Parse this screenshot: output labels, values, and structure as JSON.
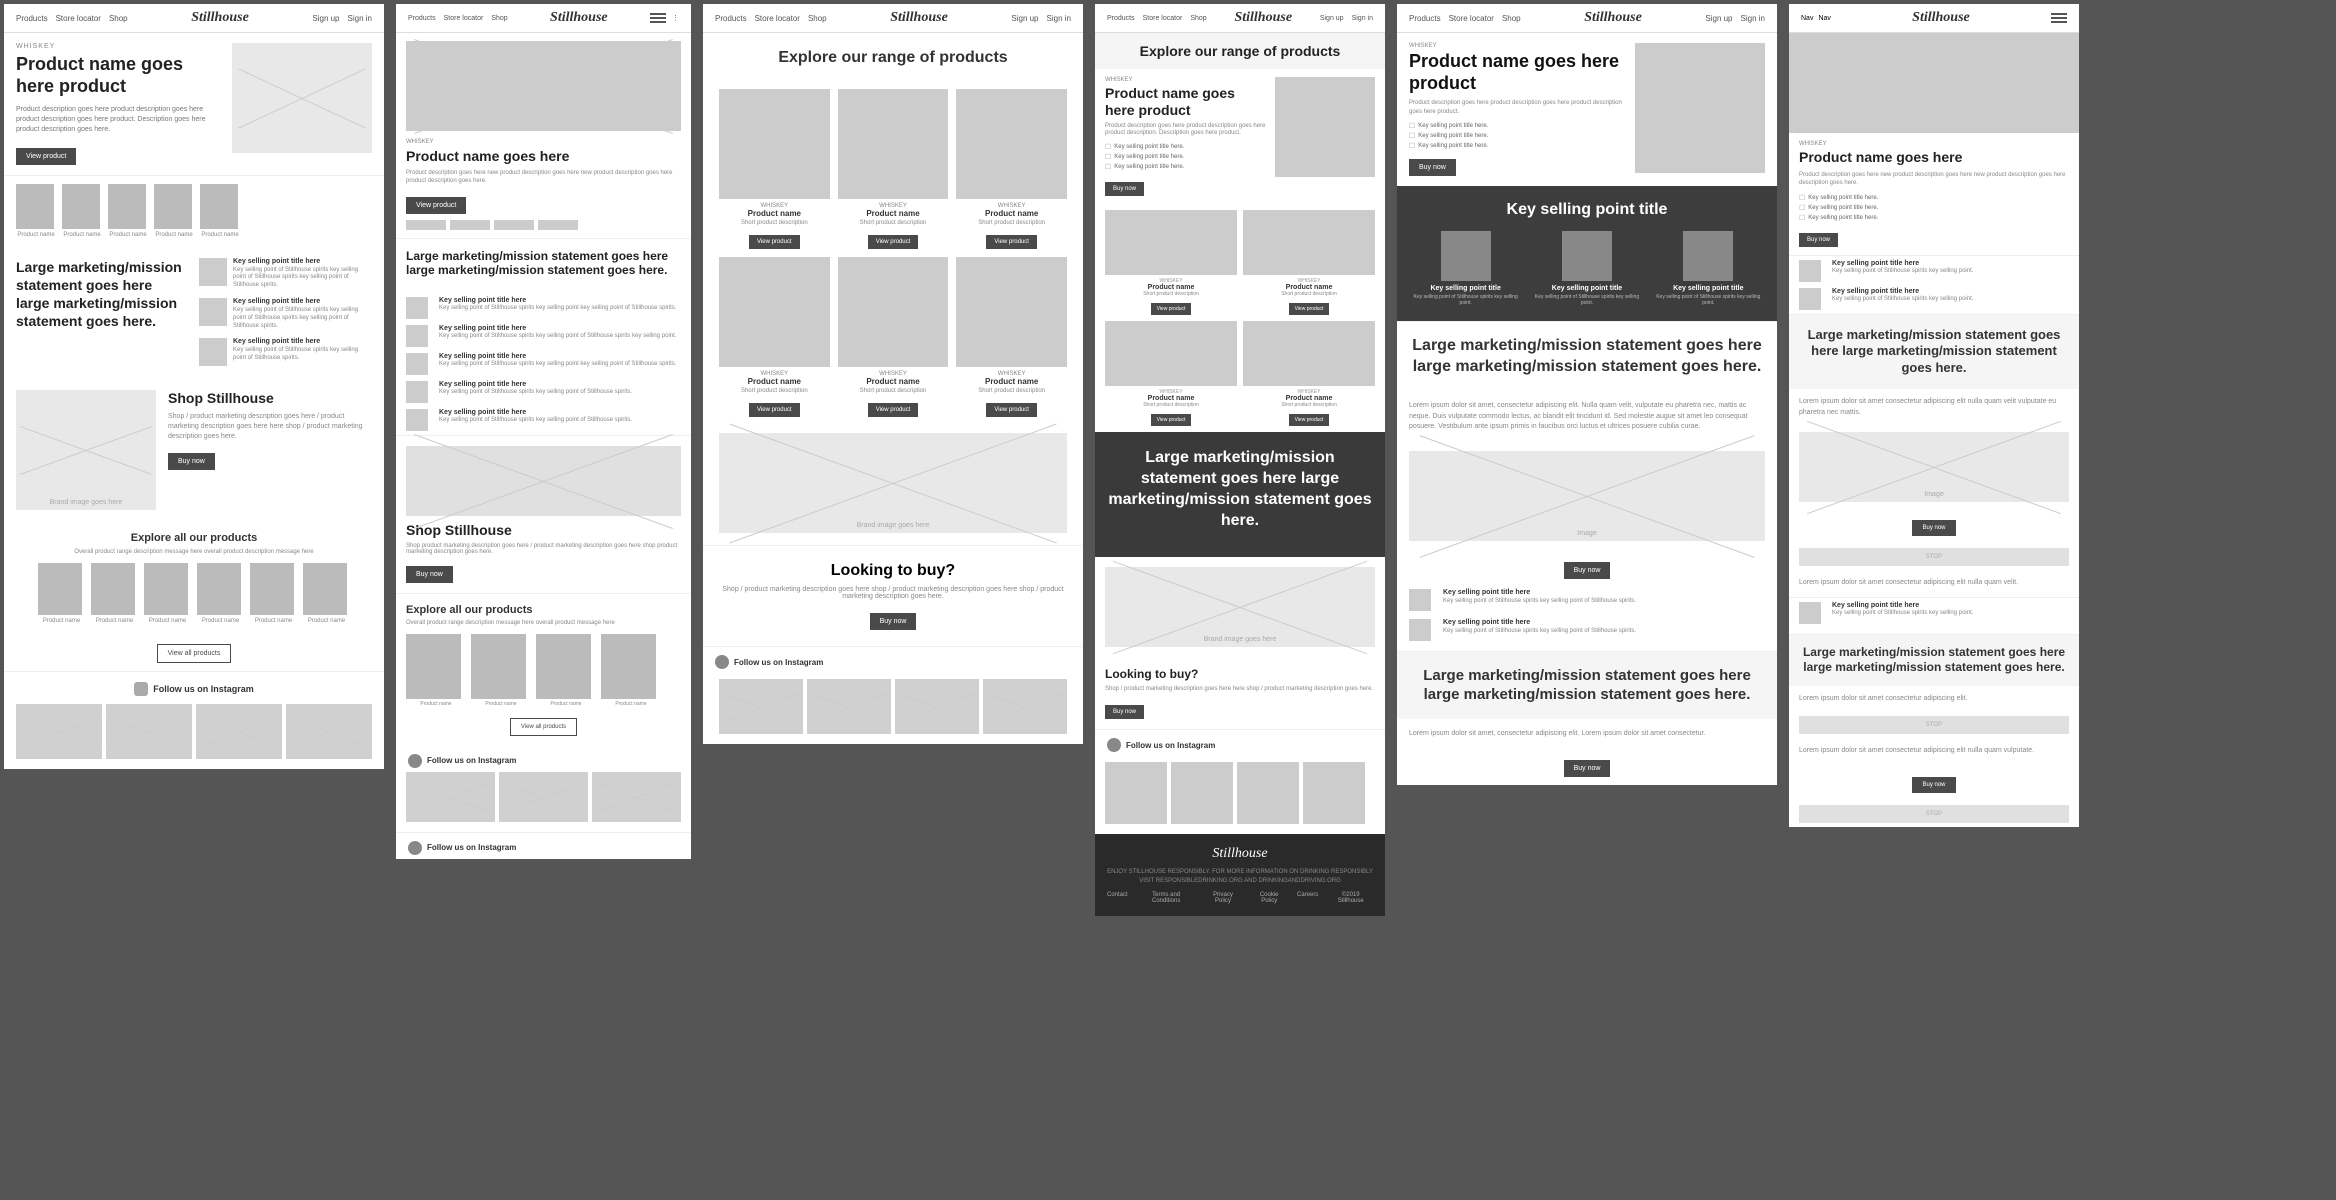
{
  "panels": [
    {
      "id": "panel1",
      "type": "homepage-full",
      "nav": {
        "links": [
          "Products",
          "Store locator",
          "Shop"
        ],
        "logo": "Stillhouse",
        "right": [
          "Sign up",
          "Sign in"
        ]
      },
      "hero": {
        "eyebrow": "WHISKEY",
        "title": "Product name goes here product",
        "description": "Product description goes here product description goes here product description goes here product. Description goes here product description goes here.",
        "cta": "View product"
      },
      "thumbs": [
        {
          "label": "Product name"
        },
        {
          "label": "Product name"
        },
        {
          "label": "Product name"
        },
        {
          "label": "Product name"
        },
        {
          "label": "Product name"
        }
      ],
      "marketing": {
        "title": "Large marketing/mission statement goes here large marketing/mission statement goes here."
      },
      "sellingPoints": [
        {
          "title": "Key selling point title here",
          "desc": "Key selling point of Stillhouse spirits key selling point of Stillhouse spirits key selling point of Stillhouse spirits."
        },
        {
          "title": "Key selling point title here",
          "desc": "Key selling point of Stillhouse spirits key selling point of Stillhouse spirits key selling point of Stillhouse spirits."
        },
        {
          "title": "Key selling point title here",
          "desc": "Key selling point of Stillhouse spirits key selling point of Stillhouse spirits."
        }
      ],
      "shopSection": {
        "title": "Shop Stillhouse",
        "desc": "Shop / product marketing description goes here / product marketing description goes here here shop / product marketing description goes here.",
        "cta": "Buy now"
      },
      "exploreSection": {
        "title": "Explore all our products",
        "desc": "Overall product range description message here overall product description message here",
        "products": [
          {
            "label": "Product name"
          },
          {
            "label": "Product name"
          },
          {
            "label": "Product name"
          },
          {
            "label": "Product name"
          },
          {
            "label": "Product name"
          },
          {
            "label": "Product name"
          }
        ],
        "cta": "View all products"
      },
      "instagram": {
        "title": "Follow us on Instagram",
        "images": [
          "Instagram feed image 1",
          "Instagram feed image 2",
          "Instagram feed image 3",
          "Instagram feed image 4"
        ]
      }
    },
    {
      "id": "panel2",
      "type": "mobile-homepage",
      "nav": {
        "links": [
          "Products",
          "Store locator",
          "Shop"
        ],
        "logo": "Stillhouse",
        "right": [
          "Sign up",
          "Sign in"
        ],
        "hamburger": true
      },
      "hero": {
        "eyebrow": "WHISKEY",
        "title": "Product name goes here",
        "description": "Product description goes here new product description goes here new product description goes here product description goes here.",
        "cta": "View product"
      },
      "marketing": {
        "title": "Large marketing/mission statement goes here large marketing/mission statement goes here."
      },
      "sellingPoints": [
        {
          "title": "Key selling point title here",
          "desc": "Key selling point of Stillhouse spirits key selling point key selling point of Stillhouse spirits."
        },
        {
          "title": "Key selling point title here",
          "desc": "Key selling point of Stillhouse spirits key selling point of Stillhouse spirits key selling point."
        },
        {
          "title": "Key selling point title here",
          "desc": "Key selling point of Stillhouse spirits key selling point key selling point of Stillhouse spirits."
        },
        {
          "title": "Key selling point title here",
          "desc": "Key selling point of Stillhouse spirits key selling point of Stillhouse spirits."
        },
        {
          "title": "Key selling point title here",
          "desc": "Key selling point of Stillhouse spirits key selling point of Stillhouse spirits."
        }
      ],
      "shopSection": {
        "title": "Shop Stillhouse",
        "desc": "Shop product marketing description goes here / product marketing description goes here shop product marketing description goes here.",
        "cta": "Buy now"
      },
      "exploreSection": {
        "title": "Explore all our products",
        "desc": "Overall product range description message here overall product message here",
        "products": [
          {
            "label": "Product name"
          },
          {
            "label": "Product name"
          },
          {
            "label": "Product name"
          },
          {
            "label": "Product name"
          }
        ],
        "cta": "View all products"
      },
      "instagram": {
        "title": "Follow us on Instagram"
      },
      "followInstagram": {
        "title": "Follow us on Instagram"
      }
    },
    {
      "id": "panel3",
      "type": "product-listing",
      "nav": {
        "links": [
          "Products",
          "Store locator",
          "Shop"
        ],
        "logo": "Stillhouse",
        "right": [
          "Sign up",
          "Sign in"
        ]
      },
      "listing": {
        "title": "Explore our range of products",
        "subtitle": ""
      },
      "products": [
        {
          "eyebrow": "WHISKEY",
          "title": "Product name",
          "desc": "Short product description"
        },
        {
          "eyebrow": "WHISKEY",
          "title": "Product name",
          "desc": "Short product description"
        },
        {
          "eyebrow": "WHISKEY",
          "title": "Product name",
          "desc": "Short product description"
        },
        {
          "eyebrow": "WHISKEY",
          "title": "Product name",
          "desc": "Short product description"
        },
        {
          "eyebrow": "WHISKEY",
          "title": "Product name",
          "desc": "Short product description"
        },
        {
          "eyebrow": "WHISKEY",
          "title": "Product name",
          "desc": "Short product description"
        }
      ],
      "buySection": {
        "title": "Looking to buy?",
        "desc": "Shop / product marketing description goes here shop / product marketing description goes here shop / product marketing description goes here.",
        "cta": "Buy now"
      },
      "instagram": {
        "title": "Follow us on Instagram"
      }
    },
    {
      "id": "panel4",
      "type": "range-page",
      "nav": {
        "links": [
          "Products",
          "Store locator",
          "Shop"
        ],
        "logo": "Stillhouse",
        "right": [
          "Sign up",
          "Sign in"
        ]
      },
      "range": {
        "title": "Explore our range of products",
        "eyebrow": "WHISKEY"
      },
      "hero": {
        "eyebrow": "WHISKEY",
        "title": "Product name goes here product",
        "description": "Product description goes here product description goes here product description. Description goes here product.",
        "checklist": [
          "Key selling point title here.",
          "Key selling point title here.",
          "Key selling point title here."
        ],
        "cta": "Buy now"
      },
      "products": [
        {
          "eyebrow": "WHISKEY",
          "title": "Product name",
          "desc": "Short product description",
          "cta": "View product"
        },
        {
          "eyebrow": "WHISKEY",
          "title": "Product name",
          "desc": "Short product description",
          "cta": "View product"
        },
        {
          "eyebrow": "WHISKEY",
          "title": "Product name",
          "desc": "Short product description",
          "cta": "View product"
        },
        {
          "eyebrow": "WHISKEY",
          "title": "Product name",
          "desc": "Short product description",
          "cta": "View product"
        }
      ],
      "darkSection": {
        "title": "Large marketing/mission statement goes here large marketing/mission statement goes here."
      },
      "buySection": {
        "title": "Looking to buy?",
        "desc": "Shop / product marketing description goes here here shop / product marketing description goes here.",
        "cta": "Buy now"
      },
      "instagram": {
        "title": "Follow us on Instagram"
      },
      "footer": {
        "logo": "Stillhouse",
        "tagline": "ENJOY STILLHOUSE RESPONSIBLY. FOR MORE INFORMATION ON DRINKING RESPONSIBLY VISIT RESPONSIBLEDRINKING.ORG AND DRINKINGANDDRIVING.ORG",
        "links": [
          "Contact",
          "Terms and Conditions",
          "Privacy Policy",
          "Cookie Policy",
          "Careers",
          "©2019 Stillhouse"
        ]
      }
    },
    {
      "id": "panel5",
      "type": "product-detail",
      "nav": {
        "links": [
          "Products",
          "Store locator",
          "Shop"
        ],
        "logo": "Stillhouse",
        "right": [
          "Sign up",
          "Sign in"
        ]
      },
      "hero": {
        "eyebrow": "WHISKEY",
        "title": "Product name goes here product",
        "description": "Product description goes here product description goes here product description goes here product.",
        "checklist": [
          "Key selling point title here.",
          "Key selling point title here.",
          "Key selling point title here."
        ],
        "cta": "Buy now"
      },
      "darkSection": {
        "points": [
          {
            "title": "Key selling point title",
            "desc": "Key selling point of Stillhouse spirits key selling point."
          },
          {
            "title": "Key selling point title",
            "desc": "Key selling point of Stillhouse spirits key selling point."
          },
          {
            "title": "Key selling point title",
            "desc": "Key selling point of Stillhouse spirits key selling point."
          }
        ]
      },
      "marketingStatement": {
        "text": "Large marketing/mission statement goes here large marketing/mission statement goes here."
      },
      "loremSection": {
        "text": "Lorem ipsum dolor sit amet, consectetur adipiscing elit. Nulla quam velit, vulputate eu pharetra nec, mattis ac neque. Duis vulputate commodo lectus, ac blandit elit tincidunt id. Sed molestie augue sit amet leo consequat posuere. Vestibulum ante ipsum primis in faucibus orci luctus et ultrices posuere cubilia curae."
      },
      "buySection": {
        "title": "Buy now",
        "cta": "Buy now"
      },
      "sellingPoints": [
        {
          "title": "Key selling point title here",
          "desc": "Key selling point of Stillhouse spirits key selling point of Stillhouse spirits."
        },
        {
          "title": "Key selling point title here",
          "desc": "Key selling point of Stillhouse spirits key selling point of Stillhouse spirits."
        }
      ],
      "marketingStatement2": {
        "text": "Large marketing/mission statement goes here large marketing/mission statement goes here."
      }
    },
    {
      "id": "panel6",
      "type": "mobile-product",
      "nav": {
        "logo": "Stillhouse",
        "right": [
          "Nav",
          "Nav"
        ],
        "hamburger": true
      },
      "hero": {
        "eyebrow": "WHISKEY",
        "title": "Product name goes here",
        "description": "Product description goes here new product description goes here new product description goes here description goes here.",
        "checklist": [
          "Key selling point title here.",
          "Key selling point title here.",
          "Key selling point title here."
        ],
        "cta": "Buy now"
      },
      "sellingPoints": [
        {
          "title": "Key selling point title here",
          "desc": "Key selling point of Stillhouse spirits key selling point."
        },
        {
          "title": "Key selling point title here",
          "desc": "Key selling point of Stillhouse spirits key selling point."
        }
      ],
      "marketingStatement": {
        "text": "Large marketing/mission statement goes here large marketing/mission statement goes here."
      },
      "loremSection": {
        "text": "Lorem ipsum dolor sit amet consectetur adipiscing elit nulla quam velit vulputate eu pharetra nec mattis."
      },
      "sections": [
        {
          "type": "gray",
          "label": "STOP"
        },
        {
          "type": "gray",
          "label": "STOP"
        },
        {
          "type": "gray",
          "label": "STOP"
        }
      ]
    }
  ]
}
